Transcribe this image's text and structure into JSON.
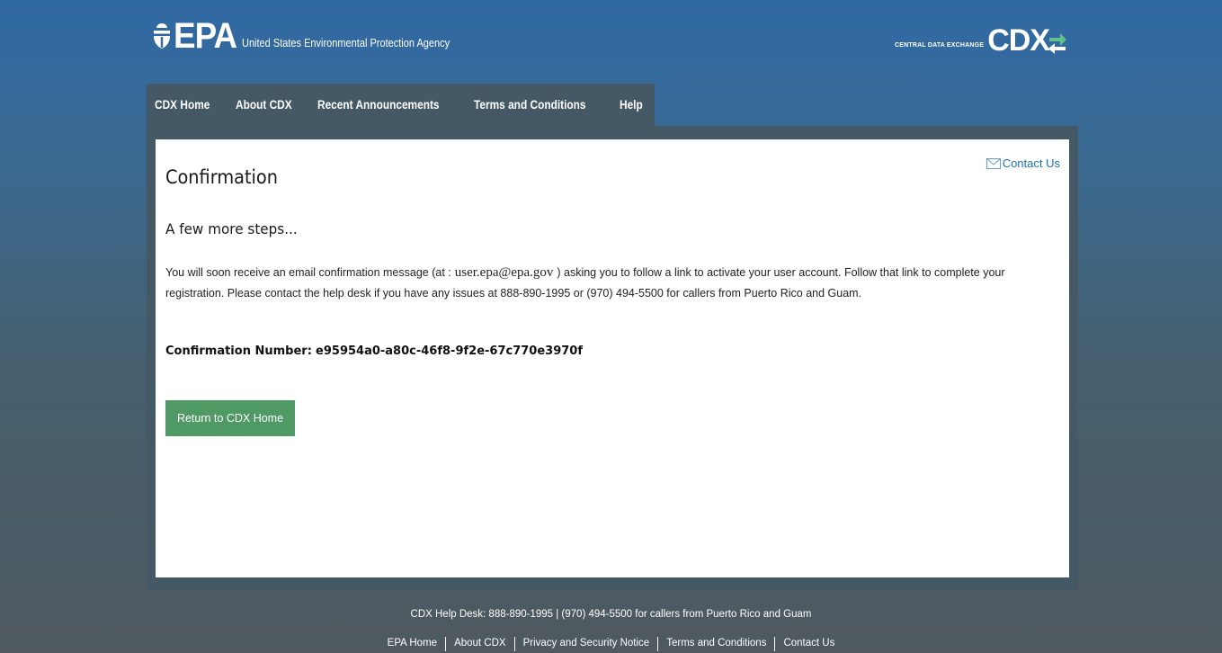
{
  "header": {
    "epa_logo_text": "EPA",
    "agency_name": "United States Environmental Protection Agency",
    "cdx_small": "CENTRAL DATA EXCHANGE",
    "cdx_text": "CDX"
  },
  "nav": {
    "items": [
      {
        "label": "CDX Home"
      },
      {
        "label": "About CDX"
      },
      {
        "label": "Recent Announcements"
      },
      {
        "label": "Terms and Conditions"
      },
      {
        "label": "Help"
      }
    ]
  },
  "page": {
    "title": "Confirmation",
    "contact_label": "Contact Us",
    "subheading": "A few more steps...",
    "para_before": "You will soon receive an email confirmation message (at :",
    "email": "user.epa@epa.gov",
    "para_after": ") asking you to follow a link to activate your user account. Follow that link to complete your registration. Please contact the help desk if you have any issues at 888-890-1995 or (970) 494-5500 for callers from Puerto Rico and Guam.",
    "confirmation_label": "Confirmation Number:",
    "confirmation_number": "e95954a0-a80c-46f8-9f2e-67c770e3970f",
    "return_button": "Return to CDX Home"
  },
  "footer": {
    "help_desk": "CDX Help Desk: 888-890-1995 | (970) 494-5500 for callers from Puerto Rico and Guam",
    "links": [
      {
        "label": "EPA Home"
      },
      {
        "label": "About CDX"
      },
      {
        "label": "Privacy and Security Notice"
      },
      {
        "label": "Terms and Conditions"
      },
      {
        "label": "Contact Us"
      }
    ]
  },
  "colors": {
    "nav_background": "#445866",
    "button": "#4f9a64",
    "link": "#1f6fb2"
  }
}
